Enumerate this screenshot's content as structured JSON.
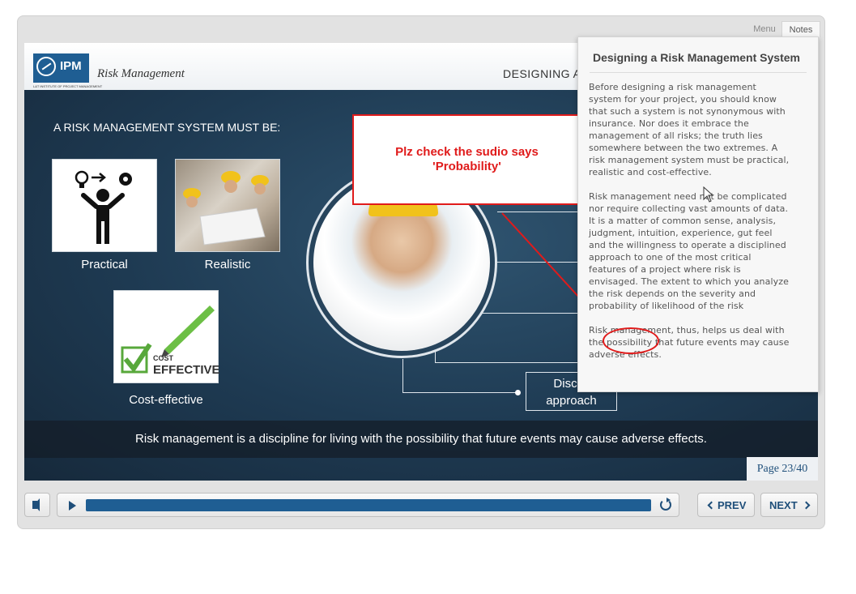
{
  "header": {
    "logo_text": "IPM",
    "logo_subtext": "L&T INSTITUTE OF PROJECT MANAGEMENT",
    "course_title": "Risk Management",
    "section_title": "DESIGNING A"
  },
  "slide": {
    "heading": "A RISK MANAGEMENT SYSTEM MUST BE:",
    "cards": [
      {
        "label": "Practical",
        "icon": "person-idea-gear-icon"
      },
      {
        "label": "Realistic",
        "icon": "workers-with-blueprint-photo"
      },
      {
        "label": "Cost-effective",
        "icon": "cost-effective-checkmark-icon"
      }
    ],
    "cost_card_text": "COST EFFECTIVE",
    "approach_label": "Discipl\napproach",
    "caption": "Risk management is a discipline for living with the possibility that future events may cause adverse effects."
  },
  "annotation": {
    "text": "Plz check the sudio says\n'Probability'",
    "color": "#e01b1b"
  },
  "notes": {
    "title": "Designing a Risk Management System",
    "paragraphs": [
      "Before designing a risk management system for your project, you should know that such a system is not synonymous with insurance. Nor does it embrace the management of all risks; the truth lies somewhere between the two extremes. A risk management system must be practical, realistic and cost-effective.",
      "Risk management need not be complicated nor require collecting vast amounts of data. It is a matter of common sense, analysis, judgment, intuition, experience, gut feel and the willingness to operate a disciplined approach to one of the most critical features of a project where risk is envisaged. The extent to which you analyze the risk depends on the severity and probability of likelihood of the risk",
      "Risk management, thus, helps us deal with the possibility that future events may cause adverse effects."
    ]
  },
  "tabs": {
    "menu": "Menu",
    "notes": "Notes"
  },
  "page_indicator": "Page 23/40",
  "controls": {
    "prev_label": "PREV",
    "next_label": "NEXT",
    "progress": 1.0
  },
  "colors": {
    "accent": "#1f5e93",
    "annotation": "#e01b1b"
  }
}
